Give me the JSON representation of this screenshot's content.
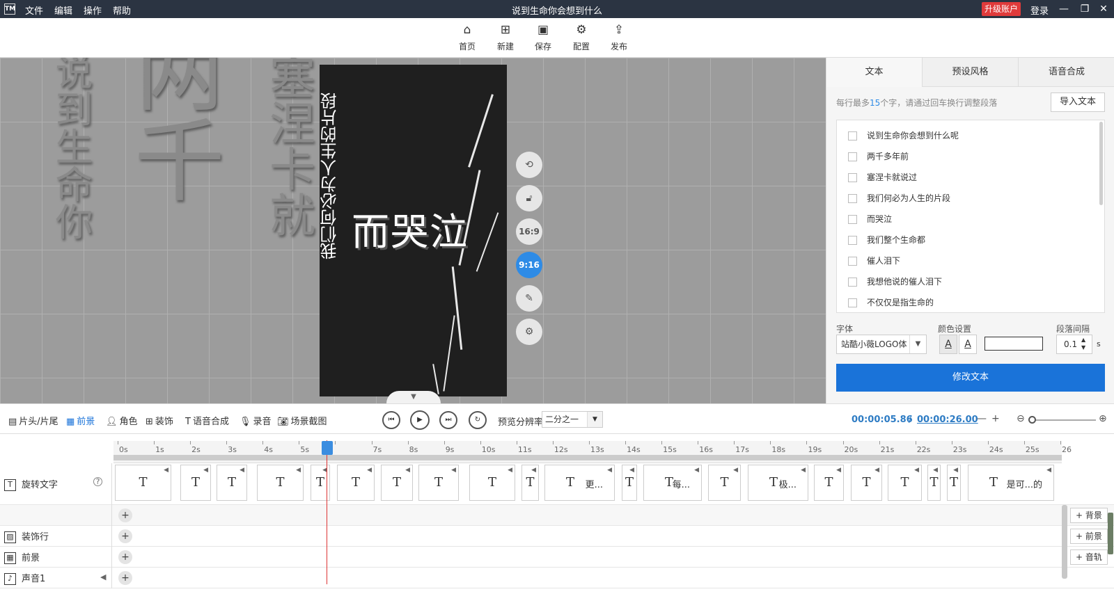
{
  "app": {
    "logo": "TM",
    "title": "说到生命你会想到什么"
  },
  "menu": [
    "文件",
    "编辑",
    "操作",
    "帮助"
  ],
  "titlebar": {
    "upgrade": "升级账户",
    "login": "登录"
  },
  "toolbar": [
    {
      "label": "首页",
      "icon": "home-icon"
    },
    {
      "label": "新建",
      "icon": "new-icon"
    },
    {
      "label": "保存",
      "icon": "save-icon"
    },
    {
      "label": "配置",
      "icon": "settings-icon"
    },
    {
      "label": "发布",
      "icon": "publish-icon"
    }
  ],
  "canvas": {
    "bg_texts": [
      "说到生命你",
      "两千",
      "塞涅卡就"
    ],
    "phone_vertical": "我们何必为人生的片段",
    "phone_main": "而哭泣"
  },
  "side_buttons": {
    "ratio_169": "16:9",
    "ratio_916": "9:16"
  },
  "right_panel": {
    "tabs": [
      "文本",
      "预设风格",
      "语音合成"
    ],
    "hint_pre": "每行最多",
    "hint_num": "15",
    "hint_post": "个字，请通过回车换行调整段落",
    "import": "导入文本",
    "lines": [
      "说到生命你会想到什么呢",
      "两千多年前",
      "塞涅卡就说过",
      "我们何必为人生的片段",
      "而哭泣",
      "我们整个生命都",
      "催人泪下",
      "我想他说的催人泪下",
      "不仅仅是指生命的"
    ],
    "font_label": "字体",
    "font_value": "站酷小薇LOGO体",
    "color_label": "颜色设置",
    "spacing_label": "段落间隔",
    "spacing_value": "0.1",
    "spacing_unit": "s",
    "apply": "修改文本"
  },
  "tool_row": {
    "items": [
      "片头/片尾",
      "前景",
      "角色",
      "装饰",
      "语音合成",
      "录音",
      "场景截图"
    ],
    "preview_label": "预览分辨率",
    "preview_value": "二分之一",
    "current_time": "00:00:05.86",
    "sep": "/",
    "total_time": "00:00:26.00"
  },
  "timeline": {
    "ticks": [
      "0s",
      "1s",
      "2s",
      "3s",
      "4s",
      "5s",
      "",
      "7s",
      "8s",
      "9s",
      "10s",
      "11s",
      "12s",
      "13s",
      "14s",
      "15s",
      "16s",
      "17s",
      "18s",
      "19s",
      "20s",
      "21s",
      "22s",
      "23s",
      "24s",
      "25s",
      "26"
    ],
    "tracks": [
      "旋转文字",
      "装饰行",
      "前景",
      "声音1"
    ],
    "clip_captions": [
      "更...",
      "每...",
      "极...",
      "是可...的"
    ],
    "side_adds": [
      "背景",
      "前景",
      "音轨"
    ]
  }
}
